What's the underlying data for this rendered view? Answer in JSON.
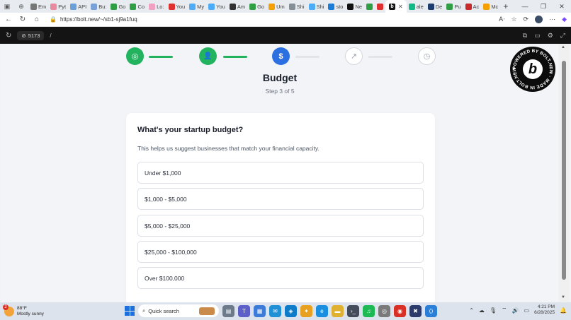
{
  "browser": {
    "tabs": [
      {
        "label": "Em",
        "color": "#777777"
      },
      {
        "label": "Pyt",
        "color": "#e88ba0"
      },
      {
        "label": "API",
        "color": "#6a9fd8"
      },
      {
        "label": "Bu:",
        "color": "#7aa0d8"
      },
      {
        "label": "Go",
        "color": "#2f9e44"
      },
      {
        "label": "Co",
        "color": "#2f9e44"
      },
      {
        "label": "Lo:",
        "color": "#f0a0c0"
      },
      {
        "label": "You",
        "color": "#e03131"
      },
      {
        "label": "My",
        "color": "#4dabf7"
      },
      {
        "label": "You",
        "color": "#4dabf7"
      },
      {
        "label": "Am",
        "color": "#333333"
      },
      {
        "label": "Go",
        "color": "#2f9e44"
      },
      {
        "label": "Um",
        "color": "#f59f00"
      },
      {
        "label": "Shi",
        "color": "#868e96"
      },
      {
        "label": "Shi",
        "color": "#4dabf7"
      },
      {
        "label": "sto",
        "color": "#1c7ed6"
      },
      {
        "label": "Ne",
        "color": "#111111"
      },
      {
        "label": "",
        "color": "#2f9e44"
      },
      {
        "label": "",
        "color": "#e03131"
      }
    ],
    "active_tab_letter": "b",
    "tabs_after": [
      {
        "label": "ale",
        "color": "#12b886"
      },
      {
        "label": "De",
        "color": "#1c3d6e"
      },
      {
        "label": "Pu",
        "color": "#2f9e44"
      },
      {
        "label": "Ac",
        "color": "#c92a2a"
      },
      {
        "label": "Mc",
        "color": "#f59f00"
      }
    ],
    "url": "https://bolt.new/~/sb1-sj9a1fuq"
  },
  "boltbar": {
    "port": "5173",
    "path": "/"
  },
  "stepper": {
    "steps": [
      {
        "status": "done",
        "icon": "target-icon",
        "glyph": "◎"
      },
      {
        "status": "done",
        "icon": "user-icon",
        "glyph": "👤"
      },
      {
        "status": "current",
        "icon": "dollar-icon",
        "glyph": "$"
      },
      {
        "status": "todo",
        "icon": "trending-up-icon",
        "glyph": "↗"
      },
      {
        "status": "todo",
        "icon": "clock-icon",
        "glyph": "◷"
      }
    ],
    "title": "Budget",
    "subtitle": "Step 3 of 5",
    "colors": {
      "done": "#22b35e",
      "current": "#2c6fe0"
    }
  },
  "card": {
    "question": "What's your startup budget?",
    "description": "This helps us suggest businesses that match your financial capacity.",
    "options": [
      "Under $1,000",
      "$1,000 - $5,000",
      "$5,000 - $25,000",
      "$25,000 - $100,000",
      "Over $100,000"
    ]
  },
  "badge": {
    "letter": "b",
    "ring_text": "POWERED BY BOLT.NEW · MADE IN BOLT.NEW ·"
  },
  "taskbar": {
    "weather_temp": "88°F",
    "weather_desc": "Mostly sunny",
    "weather_badge": "2",
    "search_placeholder": "Quick search",
    "time": "4:21 PM",
    "date": "6/28/2025"
  }
}
